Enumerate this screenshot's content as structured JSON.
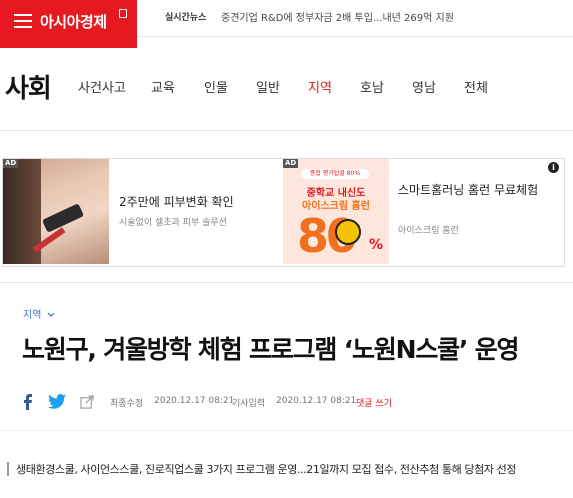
{
  "header": {
    "logo_text": "아시아경제",
    "ticker_label": "실시간뉴스",
    "ticker_text": "중견기업 R&D에 정부자금 2배 투입...내년 269억 지원"
  },
  "nav": {
    "section_title": "사회",
    "items": [
      {
        "label": "사건사고"
      },
      {
        "label": "교육"
      },
      {
        "label": "인물"
      },
      {
        "label": "일반"
      },
      {
        "label": "지역"
      },
      {
        "label": "호남"
      },
      {
        "label": "영남"
      },
      {
        "label": "전체"
      }
    ],
    "active_label": "지역",
    "active_color": "#e5191f"
  },
  "ads": {
    "badge": "AD",
    "ad1": {
      "title": "2주만에 피부변화 확인",
      "subtitle": "시술없이 셀초과 피부 솔루션"
    },
    "ad2": {
      "image_top": "종합 평가탑클 80%",
      "image_line1": "중학교 내신도",
      "image_line2": "아이스크림 홈런",
      "image_big": "80",
      "image_pct": "%",
      "title": "스마트홈러닝 홈런 무료체험",
      "subtitle": "아이스크림 홈런"
    },
    "info_icon": "i"
  },
  "article": {
    "category": "지역",
    "headline": "노원구, 겨울방학 체험 프로그램 ‘노원N스쿨’ 운영",
    "updated_label": "최종수정",
    "updated_at": "2020.12.17 08:21",
    "published_label": "기사입력",
    "published_at": "2020.12.17 08:21",
    "comment_label": "댓글 쓰기",
    "summary": "생태환경스쿨, 사이언스스쿨, 진로직업스쿨 3가지 프로그램 운영...21일까지 모집 접수, 전산추첨 통해 당첨자 선정"
  },
  "icons": {
    "menu": "hamburger-icon",
    "facebook": "facebook-icon",
    "twitter": "twitter-icon",
    "share": "share-icon",
    "chevron": "chevron-down-icon"
  },
  "colors": {
    "brand": "#e5191f",
    "link": "#3b6fc9",
    "facebook": "#3b5998",
    "twitter": "#1da1f2"
  }
}
